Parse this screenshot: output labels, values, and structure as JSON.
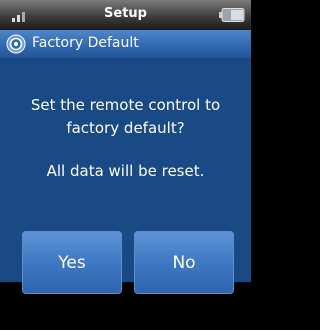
{
  "status_bar": {
    "title": "Setup",
    "signal_icon": "signal-strength-icon",
    "battery_icon": "battery-icon"
  },
  "header": {
    "icon": "settings-gear-icon",
    "title": "Factory Default"
  },
  "dialog": {
    "prompt": "Set the remote control to factory default?",
    "warning": "All data will be reset.",
    "yes_label": "Yes",
    "no_label": "No"
  },
  "colors": {
    "status_bar": "#3e3e3e",
    "header": "#2f67b0",
    "panel": "#1a4a86",
    "button": "#3d76c0",
    "background": "#000000"
  }
}
